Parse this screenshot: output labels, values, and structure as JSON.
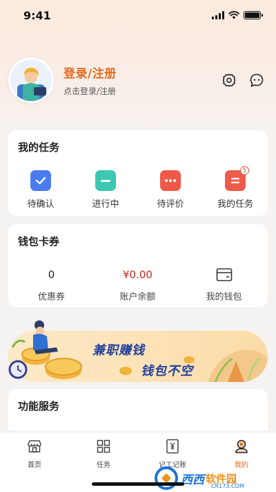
{
  "status_bar": {
    "time": "9:41"
  },
  "profile": {
    "title": "登录/注册",
    "subtitle": "点击登录/注册",
    "settings_icon": "gear-icon",
    "message_icon": "chat-bubble-icon"
  },
  "tasks": {
    "title": "我的任务",
    "items": [
      {
        "label": "待确认",
        "icon": "check-calendar-icon",
        "color": "#4a7cf0"
      },
      {
        "label": "进行中",
        "icon": "progress-calendar-icon",
        "color": "#3cc7b3"
      },
      {
        "label": "待评价",
        "icon": "comment-icon",
        "color": "#f0584a"
      },
      {
        "label": "我的任务",
        "icon": "list-calendar-icon",
        "color": "#ee5b4b",
        "badge": "5"
      }
    ]
  },
  "wallet": {
    "title": "钱包卡券",
    "items": [
      {
        "value": "0",
        "label": "优惠券"
      },
      {
        "value": "¥0.00",
        "label": "账户余额"
      },
      {
        "label": "我的钱包",
        "icon": "wallet-card-icon"
      }
    ]
  },
  "banner": {
    "line1": "兼职赚钱",
    "line2": "钱包不空"
  },
  "services": {
    "title": "功能服务"
  },
  "tab_bar": {
    "tabs": [
      {
        "label": "首页",
        "icon": "store-icon",
        "active": false
      },
      {
        "label": "任务",
        "icon": "grid-icon",
        "active": false
      },
      {
        "label": "记工记账",
        "icon": "ledger-icon",
        "active": false
      },
      {
        "label": "我的",
        "icon": "person-icon",
        "active": true
      }
    ]
  },
  "watermark": {
    "name": "西西",
    "suffix": "软件园",
    "url": "CR173.COM"
  },
  "colors": {
    "accent": "#e46a1f",
    "money": "#c9291d",
    "banner_text": "#1f3f9e"
  }
}
